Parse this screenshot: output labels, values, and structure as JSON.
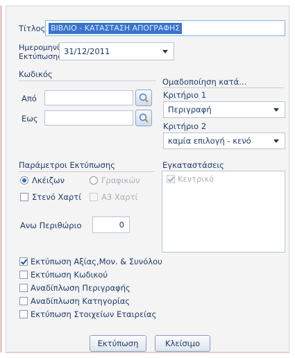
{
  "title_label": "Τίτλος",
  "title_value": "ΒΙΒΛΙΟ - ΚΑΤΑΣΤΑΣΗ ΑΠΟΓΡΑΦΗΣ",
  "print_date_label_line1": "Ημερομηνία",
  "print_date_label_line2": "Εκτύπωσης",
  "print_date_value": "31/12/2011",
  "code_section": {
    "label": "Κωδικός",
    "from_label": "Από",
    "to_label": "Εως",
    "from_value": "",
    "to_value": ""
  },
  "grouping": {
    "label": "Ομαδοποίηση κατά...",
    "criterion1_label": "Κριτήριο 1",
    "criterion1_value": "Περιγραφή",
    "criterion2_label": "Κριτήριο 2",
    "criterion2_value": "καμία επιλογή - κενό"
  },
  "print_params": {
    "label": "Παράμετροι Εκτύπωσης",
    "radio_lasers": "Λκέιζων",
    "radio_graphics": "Γραφικών",
    "narrow_paper": "Στενό Χαρτί",
    "a3_paper": "Α3 Χαρτί",
    "top_margin_label": "Ανω Περιθώριο",
    "top_margin_value": "0"
  },
  "installations": {
    "label": "Εγκαταστάσεις",
    "items": [
      "Κεντρικό"
    ]
  },
  "options": [
    "Εκτύπωση Αξίας,Μον. & Συνόλου",
    "Εκτύπωση Κωδικού",
    "Αναδίπλωση Περιγραφής",
    "Αναδίπλωση Κατηγορίας",
    "Εκτύπωση Στοιχείων Εταιρείας"
  ],
  "options_checked": [
    true,
    false,
    false,
    false,
    false
  ],
  "buttons": {
    "print": "Εκτύπωση",
    "close": "Κλείσιμο"
  },
  "colors": {
    "selection": "#3a74c9",
    "dialog_bg": "#f4f4f4"
  }
}
